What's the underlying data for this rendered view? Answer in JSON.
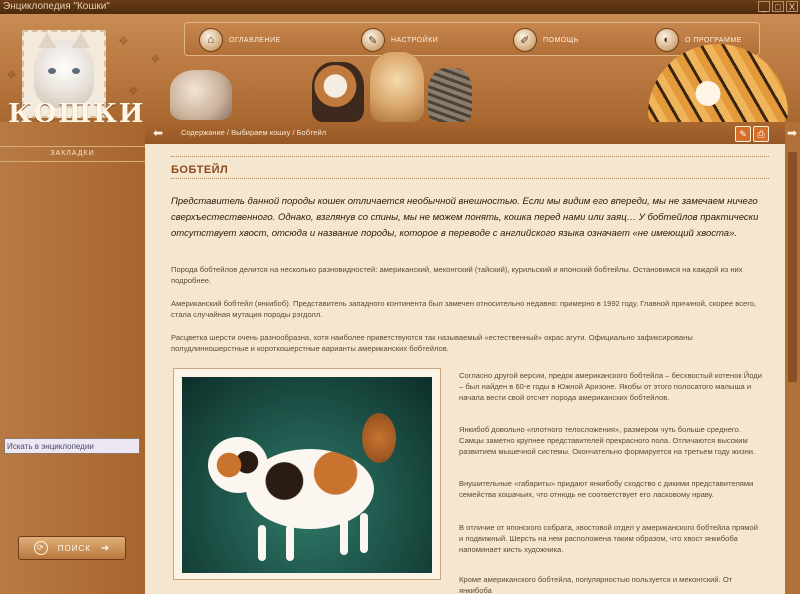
{
  "window": {
    "title": "Энциклопедия \"Кошки\"",
    "min": "_",
    "max": "□",
    "close": "X"
  },
  "logo": {
    "text": "КОШКИ"
  },
  "nav": {
    "items": [
      {
        "label": "ОГЛАВЛЕНИЕ",
        "icon": "home-icon"
      },
      {
        "label": "НАСТРОЙКИ",
        "icon": "settings-icon"
      },
      {
        "label": "ПОМОЩЬ",
        "icon": "help-icon"
      },
      {
        "label": "О ПРОГРАММЕ",
        "icon": "about-icon"
      }
    ]
  },
  "sidebar": {
    "bookmarks_label": "ЗАКЛАДКИ",
    "search_button": "ПОИСК",
    "search_input_value": "Искать в энциклопедии"
  },
  "breadcrumb": "Содержание / Выбираем кошку / Бобтейл",
  "article": {
    "title": "БОБТЕЙЛ",
    "lead": "Представитель данной породы кошек отличается необычной внешностью. Если мы видим его впереди, мы не замечаем ничего сверхъестественного. Однако, взглянув со спины, мы не можем понять, кошка перед нами или заяц… У бобтейлов практически отсутствует хвост, отсюда и название породы, которое в переводе с английского языка означает «не имеющий хвоста».",
    "p1": "Порода бобтейлов делится на несколько разновидностей: американский, меконгский (тайский), курильский и японский бобтейлы. Остановимся на каждой из них подробнее.",
    "p2": "Американский бобтейл (янкибоб). Представитель западного континента был замечен относительно недавно: примерно в 1992 году. Главной причиной, скорее всего, стала случайная мутация породы рэгдолл.",
    "p3": "Расцветка шерсти очень разнообразна, хотя наиболее приветствуются так называемый «естественный» окрас агути. Официально зафиксированы полудлинношерстные и короткошерстные варианты американских бобтейлов.",
    "right_paragraphs": [
      "Согласно другой версии, предок американского бобтейла – бесхвостый котенок Йоди – был найден в 60-е годы в Южной Аризоне. Якобы от этого полосатого малыша и начала вести свой отсчет порода американских бобтейлов.",
      "Янкибоб довольно «плотного телосложения», размером чуть больше среднего. Самцы заметно крупнее представителей прекрасного пола. Отличаются высоким развитием мышечной системы. Окончательно формируется на третьем году жизни.",
      "Внушительные «габариты» придают янкибобу сходство с дикими представителями семейства кошачьих, что отнюдь не соответствует его ласковому нраву.",
      "В отличие от японского собрата, хвостовой отдел у американского бобтейла прямой и подвижный. Шерсть на нем расположена таким образом, что хвост янкибоба напоминает кисть художника.",
      "Кроме американского бобтейла, популярностью пользуется и меконгский. От янкибоба"
    ]
  },
  "colors": {
    "accent": "#8a4a1d",
    "panel": "#f5e6cf",
    "frame": "#a9672f"
  }
}
